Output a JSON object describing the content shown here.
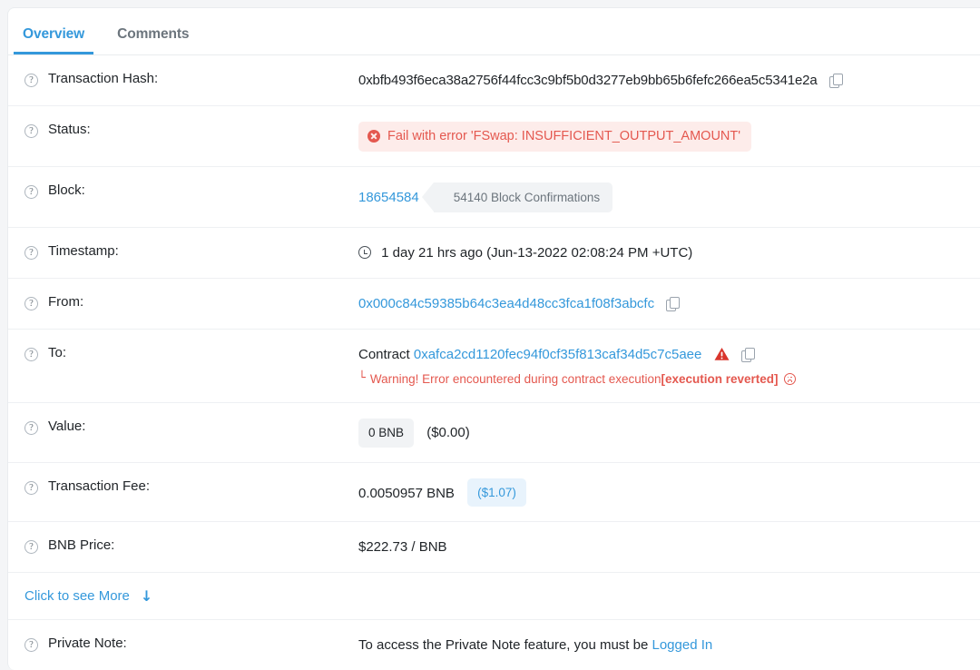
{
  "tabs": [
    {
      "label": "Overview",
      "active": true
    },
    {
      "label": "Comments",
      "active": false
    }
  ],
  "rows": {
    "transaction_hash": {
      "label": "Transaction Hash:",
      "value": "0xbfb493f6eca38a2756f44fcc3c9bf5b0d3277eb9bb65b6fefc266ea5c5341e2a"
    },
    "status": {
      "label": "Status:",
      "value": "Fail with error 'FSwap: INSUFFICIENT_OUTPUT_AMOUNT'"
    },
    "block": {
      "label": "Block:",
      "number": "18654584",
      "confirmations": "54140 Block Confirmations"
    },
    "timestamp": {
      "label": "Timestamp:",
      "value": "1 day 21 hrs ago (Jun-13-2022 02:08:24 PM +UTC)"
    },
    "from": {
      "label": "From:",
      "value": "0x000c84c59385b64c3ea4d48cc3fca1f08f3abcfc"
    },
    "to": {
      "label": "To:",
      "prefix": "Contract",
      "address": "0xafca2cd1120fec94f0cf35f813caf34d5c7c5aee",
      "warning_prefix": "Warning! Error encountered during contract execution ",
      "warning_bold": "[execution reverted]"
    },
    "value": {
      "label": "Value:",
      "amount": "0 BNB",
      "fiat": "($0.00)"
    },
    "transaction_fee": {
      "label": "Transaction Fee:",
      "amount": "0.0050957 BNB",
      "fiat": "($1.07)"
    },
    "bnb_price": {
      "label": "BNB Price:",
      "value": "$222.73 / BNB"
    },
    "see_more": {
      "label": "Click to see More",
      "arrow": "↓"
    },
    "private_note": {
      "label": "Private Note:",
      "text": "To access the Private Note feature, you must be ",
      "link": "Logged In"
    }
  },
  "icons": {
    "help": "?",
    "corner": "└"
  },
  "colors": {
    "accent": "#3498db",
    "error": "#e4584f",
    "error_bg": "#fdecea",
    "badge_bg": "#f1f3f5",
    "fiat_bg": "#e8f3fc",
    "text": "#212529",
    "muted": "#6c757d",
    "page_bg": "#f4f5f7"
  }
}
